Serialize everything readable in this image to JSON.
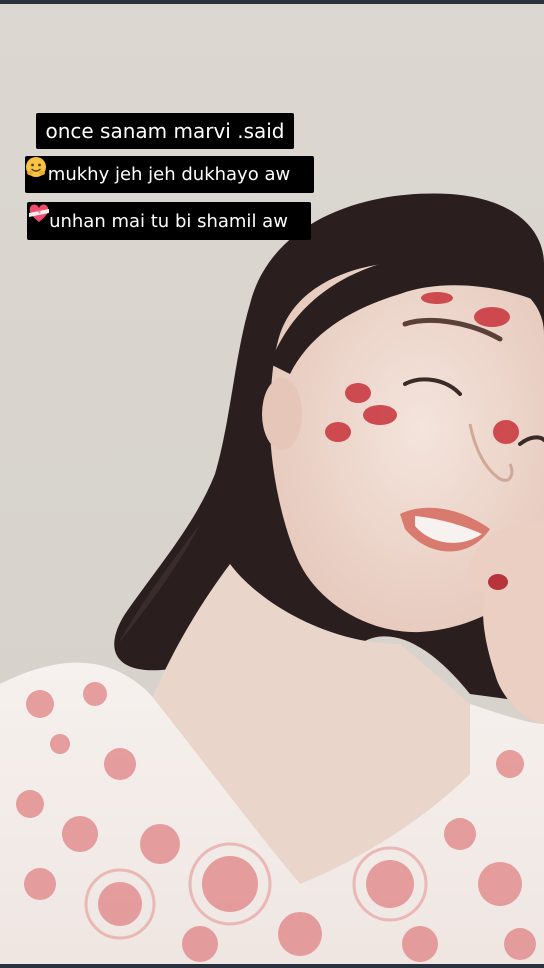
{
  "captions": [
    {
      "text": "once sanam marvi .said"
    },
    {
      "text": "mukhy jeh jeh dukhayo aw",
      "emoji": "hugging-face-icon"
    },
    {
      "text": "unhan mai tu bi shamil aw",
      "emoji": "heart-with-ribbon-icon"
    }
  ],
  "colors": {
    "background": "#d9d4ce",
    "caption_bg": "#000000",
    "caption_text": "#ffffff",
    "kiss_mark": "#c8323a"
  }
}
